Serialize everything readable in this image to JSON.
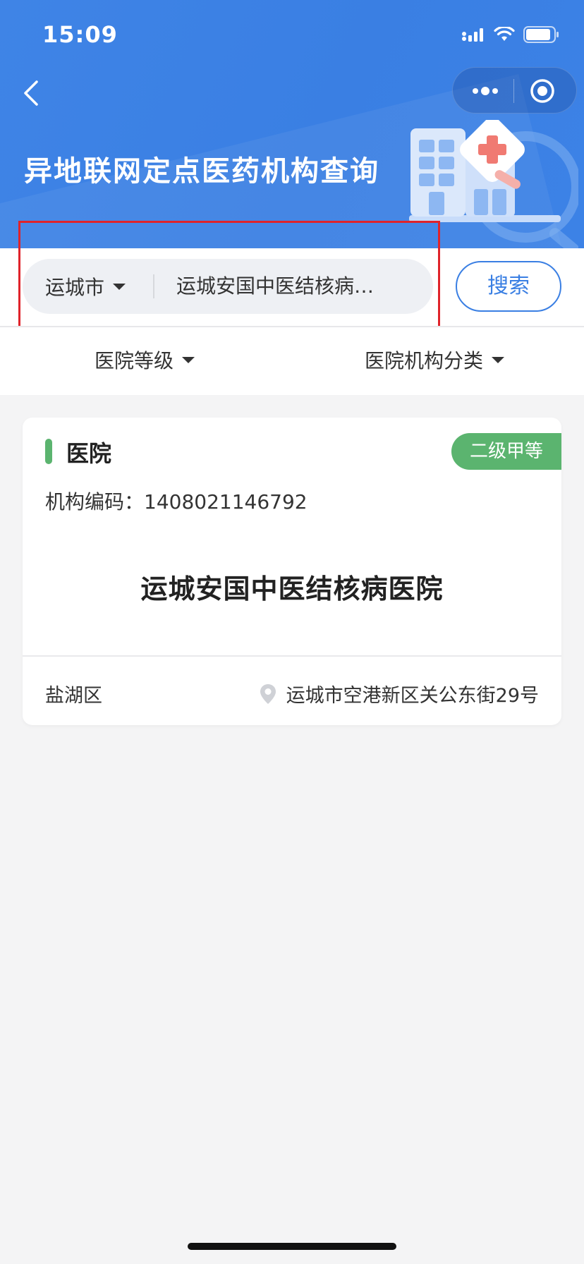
{
  "status_bar": {
    "time": "15:09"
  },
  "header": {
    "title": "异地联网定点医药机构查询"
  },
  "search": {
    "city": "运城市",
    "query": "运城安国中医结核病…",
    "button_label": "搜索"
  },
  "filters": {
    "level_label": "医院等级",
    "category_label": "医院机构分类"
  },
  "results": [
    {
      "type": "医院",
      "level": "二级甲等",
      "code_label": "机构编码：",
      "code": "1408021146792",
      "name": "运城安国中医结核病医院",
      "district": "盐湖区",
      "address": "运城市空港新区关公东街29号"
    }
  ],
  "colors": {
    "brand_blue": "#3a7fe3",
    "level_green": "#5bb46f",
    "highlight_red": "#e0232a"
  },
  "icons": [
    "back-arrow-icon",
    "more-dots-icon",
    "close-target-icon",
    "signal-icon",
    "wifi-icon",
    "battery-icon",
    "caret-down-icon",
    "location-pin-icon"
  ]
}
